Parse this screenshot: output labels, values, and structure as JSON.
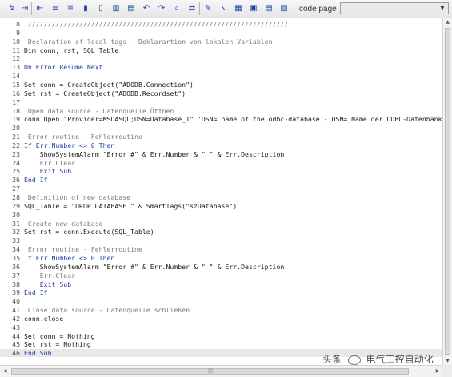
{
  "toolbar": {
    "code_page_label": "code page",
    "code_page_value": "",
    "buttons": [
      {
        "name": "compile-icon",
        "glyph": "↯"
      },
      {
        "name": "indent-icon",
        "glyph": "⇥"
      },
      {
        "name": "outdent-icon",
        "glyph": "⇤"
      },
      {
        "name": "comment-icon",
        "glyph": "≡"
      },
      {
        "name": "uncomment-icon",
        "glyph": "≣"
      },
      {
        "name": "bookmark-icon",
        "glyph": "▮"
      },
      {
        "name": "next-bookmark-icon",
        "glyph": "▯"
      },
      {
        "name": "prev-bookmark-icon",
        "glyph": "▥"
      },
      {
        "name": "clear-bookmarks-icon",
        "glyph": "▤"
      },
      {
        "name": "undo-icon",
        "glyph": "↶"
      },
      {
        "name": "redo-icon",
        "glyph": "↷"
      },
      {
        "name": "find-icon",
        "glyph": "⌕"
      },
      {
        "name": "replace-icon",
        "glyph": "⇄"
      },
      {
        "name": "tag-icon",
        "glyph": "✎"
      },
      {
        "name": "syntax-icon",
        "glyph": "⌥"
      },
      {
        "name": "grid-icon",
        "glyph": "▦"
      },
      {
        "name": "object-list-icon",
        "glyph": "▣"
      },
      {
        "name": "property-list-icon",
        "glyph": "▤"
      },
      {
        "name": "function-list-icon",
        "glyph": "▧"
      },
      {
        "name": "constant-list-icon",
        "glyph": "▨"
      },
      {
        "name": "template-icon",
        "glyph": "▩"
      }
    ]
  },
  "editor": {
    "lines": [
      {
        "num": "8",
        "code": "'//////////////////////////////////////////////////////////////////",
        "cls": "c"
      },
      {
        "num": "9",
        "code": "",
        "cls": ""
      },
      {
        "num": "10",
        "code": "'Declaration of local tags - Deklarartion von lokalen Variablen",
        "cls": "c"
      },
      {
        "num": "11",
        "code": "Dim conn, rst, SQL_Table",
        "cls": ""
      },
      {
        "num": "12",
        "code": "",
        "cls": ""
      },
      {
        "num": "13",
        "code": "On Error Resume Next",
        "cls": "k"
      },
      {
        "num": "14",
        "code": "",
        "cls": ""
      },
      {
        "num": "15",
        "code": "Set conn = CreateObject(\"ADODB.Connection\")",
        "cls": ""
      },
      {
        "num": "16",
        "code": "Set rst = CreateObject(\"ADODB.Recordset\")",
        "cls": ""
      },
      {
        "num": "17",
        "code": "",
        "cls": ""
      },
      {
        "num": "18",
        "code": "'Open data source - Datenquelle Öffnen",
        "cls": "c"
      },
      {
        "num": "19",
        "code": "conn.Open \"Provider=MSDASQL;DSN=Database_1\" 'DSN= name of the odbc-database - DSN= Name der ODBC-Datenbank",
        "cls": ""
      },
      {
        "num": "20",
        "code": "",
        "cls": ""
      },
      {
        "num": "21",
        "code": "'Error routine - Fehlerroutine",
        "cls": "c"
      },
      {
        "num": "22",
        "code": "If Err.Number <> 0 Then",
        "cls": "k"
      },
      {
        "num": "23",
        "code": "    ShowSystemAlarm \"Error #\" & Err.Number & \" \" & Err.Description",
        "cls": ""
      },
      {
        "num": "24",
        "code": "    Err.Clear",
        "cls": "c"
      },
      {
        "num": "25",
        "code": "    Exit Sub",
        "cls": "k"
      },
      {
        "num": "26",
        "code": "End If",
        "cls": "k"
      },
      {
        "num": "27",
        "code": "",
        "cls": ""
      },
      {
        "num": "28",
        "code": "'Definition of new database",
        "cls": "c"
      },
      {
        "num": "29",
        "code": "SQL_Table = \"DROP DATABASE \" & SmartTags(\"szDatabase\")",
        "cls": ""
      },
      {
        "num": "30",
        "code": "",
        "cls": ""
      },
      {
        "num": "31",
        "code": "'Create new database",
        "cls": "c"
      },
      {
        "num": "32",
        "code": "Set rst = conn.Execute(SQL_Table)",
        "cls": ""
      },
      {
        "num": "33",
        "code": "",
        "cls": ""
      },
      {
        "num": "34",
        "code": "'Error routine - Fehlerroutine",
        "cls": "c"
      },
      {
        "num": "35",
        "code": "If Err.Number <> 0 Then",
        "cls": "k"
      },
      {
        "num": "36",
        "code": "    ShowSystemAlarm \"Error #\" & Err.Number & \" \" & Err.Description",
        "cls": ""
      },
      {
        "num": "37",
        "code": "    Err.Clear",
        "cls": "c"
      },
      {
        "num": "38",
        "code": "    Exit Sub",
        "cls": "k"
      },
      {
        "num": "39",
        "code": "End If",
        "cls": "k"
      },
      {
        "num": "40",
        "code": "",
        "cls": ""
      },
      {
        "num": "41",
        "code": "'Close data source - Datenquelle schließen",
        "cls": "c"
      },
      {
        "num": "42",
        "code": "conn.close",
        "cls": ""
      },
      {
        "num": "43",
        "code": "",
        "cls": ""
      },
      {
        "num": "44",
        "code": "Set conn = Nothing",
        "cls": ""
      },
      {
        "num": "45",
        "code": "Set rst = Nothing",
        "cls": ""
      },
      {
        "num": "46",
        "code": "End Sub",
        "cls": "k",
        "current": true
      }
    ]
  },
  "watermark": {
    "left": "头条",
    "right": "电气工控自动化"
  }
}
